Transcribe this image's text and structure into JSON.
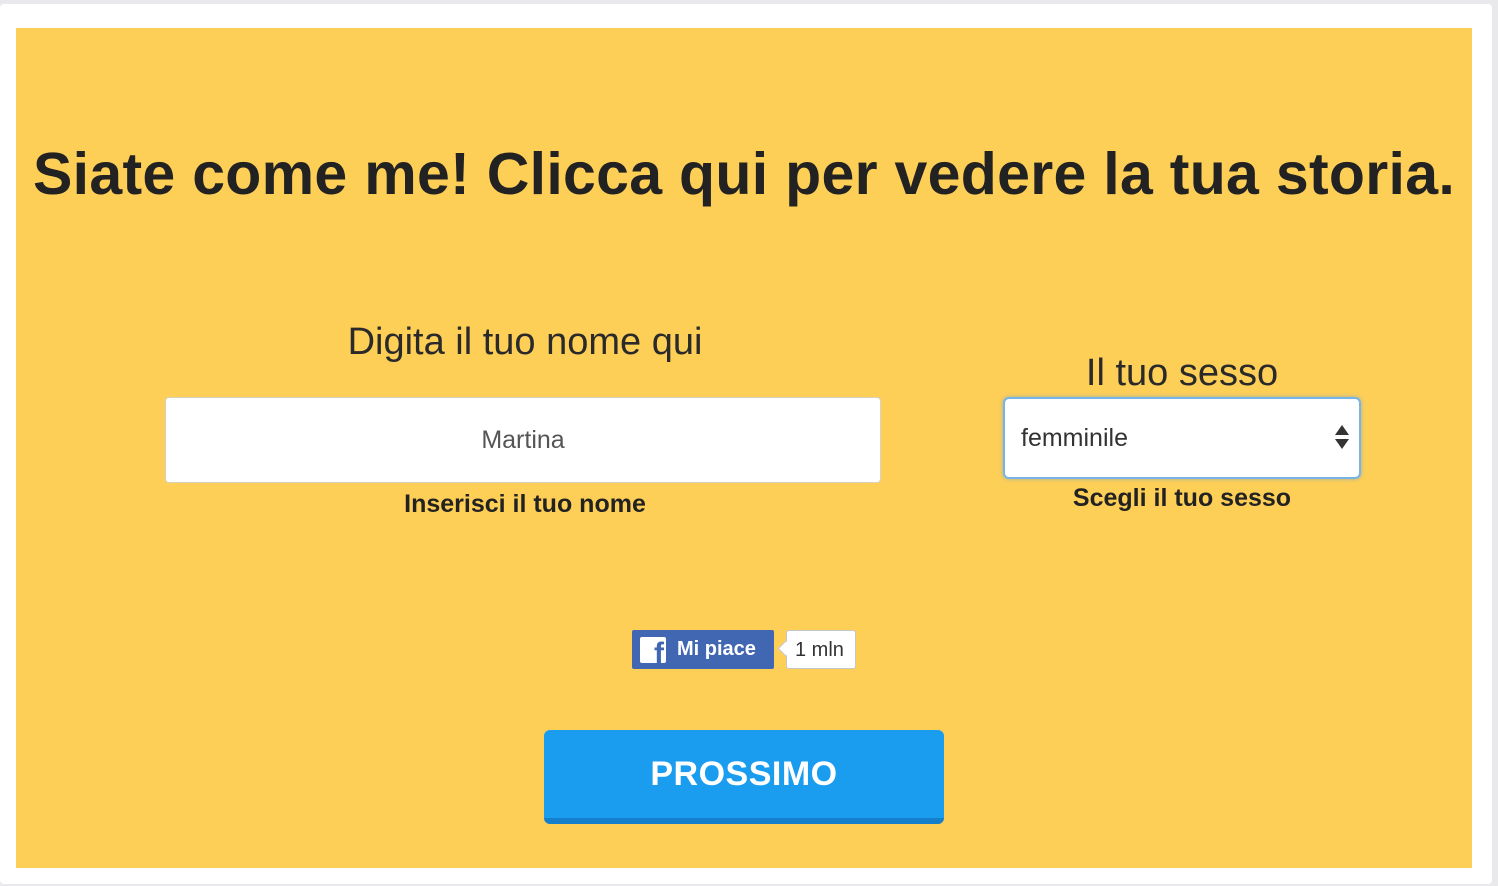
{
  "headline": "Siate come me! Clicca qui per vedere la tua storia.",
  "name_field": {
    "label": "Digita il tuo nome qui",
    "value": "Martina",
    "help": "Inserisci il tuo nome"
  },
  "sex_field": {
    "label": "Il tuo sesso",
    "selected": "femminile",
    "help": "Scegli il tuo sesso"
  },
  "facebook_like": {
    "label": "Mi piace",
    "count": "1 mln",
    "logo_letter": "f"
  },
  "next_button": {
    "label": "PROSSIMO"
  },
  "colors": {
    "panel_background": "#fecf57",
    "button_blue": "#1a9cef",
    "facebook_blue": "#4267b2"
  },
  "icons": [
    "facebook-logo-icon",
    "select-arrows-icon"
  ]
}
